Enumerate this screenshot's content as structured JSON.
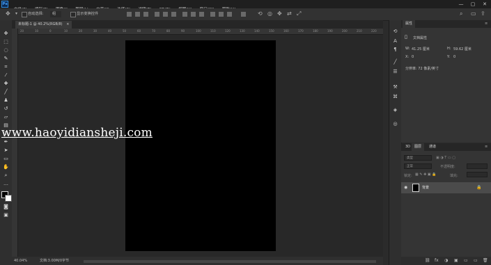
{
  "menu": {
    "app_logo": "Ps",
    "items": [
      "文件(F)",
      "编辑(E)",
      "图像(I)",
      "图层(L)",
      "文字(Y)",
      "选择(S)",
      "滤镜(T)",
      "3D(D)",
      "视图(V)",
      "窗口(W)",
      "帮助(H)"
    ],
    "window_controls": [
      "—",
      "▢",
      "✕"
    ]
  },
  "options": {
    "auto_select_label": "自动选择:",
    "auto_select_value": "组",
    "show_transform_label": "显示变换控件"
  },
  "document": {
    "tab_title": "未标题-1 @ 40.2%(RGB/8)",
    "tab_close": "×",
    "canvas_color": "#000000"
  },
  "ruler": {
    "labels": [
      "20",
      "10",
      "0",
      "10",
      "20",
      "30",
      "40",
      "50",
      "60",
      "70",
      "80",
      "90",
      "100",
      "110",
      "120",
      "130",
      "140",
      "150",
      "160",
      "170",
      "180",
      "190",
      "200",
      "210",
      "220"
    ]
  },
  "watermark": "www.haoyidiansheji.com",
  "status": {
    "zoom": "40.04%",
    "doc_info": "文档:3.00M/0字节"
  },
  "properties": {
    "tab": "属性",
    "doc_props": "文档属性",
    "w_label": "W:",
    "w_value": "41.25 厘米",
    "h_label": "H:",
    "h_value": "59.62 厘米",
    "x_label": "X:",
    "x_value": "0",
    "y_label": "Y:",
    "y_value": "0",
    "resolution": "分辨率: 72 像素/英寸"
  },
  "layers": {
    "tabs": [
      "3D",
      "图层",
      "通道"
    ],
    "kind_label": "类型",
    "blend_mode": "正常",
    "opacity_label": "不透明度:",
    "lock_label": "锁定:",
    "fill_label": "填充:",
    "layer_name": "背景",
    "footer_icons": [
      "⛓",
      "fx",
      "◑",
      "▣",
      "▭",
      "🗑"
    ]
  },
  "colors": {
    "canvas": "#000000",
    "ui_bg": "#2b2b2b",
    "accent": "#2f8ce0"
  }
}
